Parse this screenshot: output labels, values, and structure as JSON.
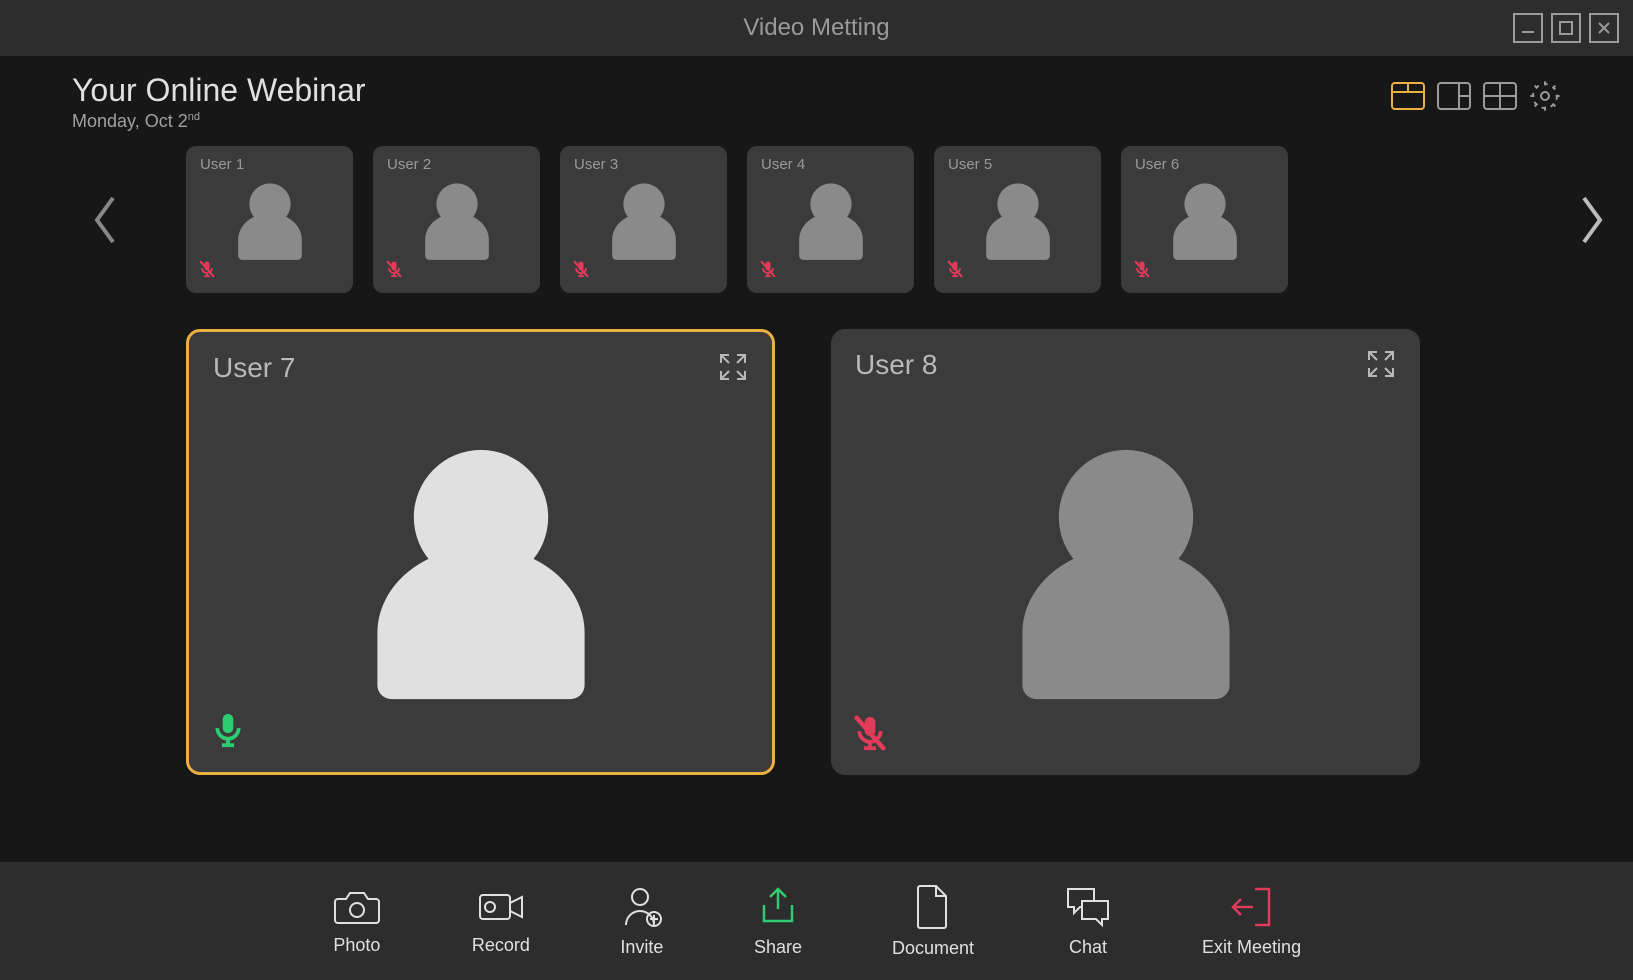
{
  "window": {
    "title": "Video Metting"
  },
  "header": {
    "title": "Your Online Webinar",
    "date_prefix": "Monday, Oct 2",
    "date_suffix": "nd"
  },
  "participants_small": [
    {
      "label": "User 1",
      "mic": "muted"
    },
    {
      "label": "User 2",
      "mic": "muted"
    },
    {
      "label": "User 3",
      "mic": "muted"
    },
    {
      "label": "User 4",
      "mic": "muted"
    },
    {
      "label": "User 5",
      "mic": "muted"
    },
    {
      "label": "User 6",
      "mic": "muted"
    }
  ],
  "participants_main": [
    {
      "label": "User 7",
      "mic": "on",
      "active": true
    },
    {
      "label": "User 8",
      "mic": "muted",
      "active": false
    }
  ],
  "toolbar": {
    "photo": {
      "label": "Photo"
    },
    "record": {
      "label": "Record"
    },
    "invite": {
      "label": "Invite"
    },
    "share": {
      "label": "Share"
    },
    "document": {
      "label": "Document"
    },
    "chat": {
      "label": "Chat"
    },
    "exit": {
      "label": "Exit Meeting"
    }
  },
  "colors": {
    "accent": "#eab141",
    "mic_on": "#2ecc71",
    "mic_muted": "#e23b5a",
    "share": "#2ecc71",
    "exit": "#e23b5a"
  }
}
